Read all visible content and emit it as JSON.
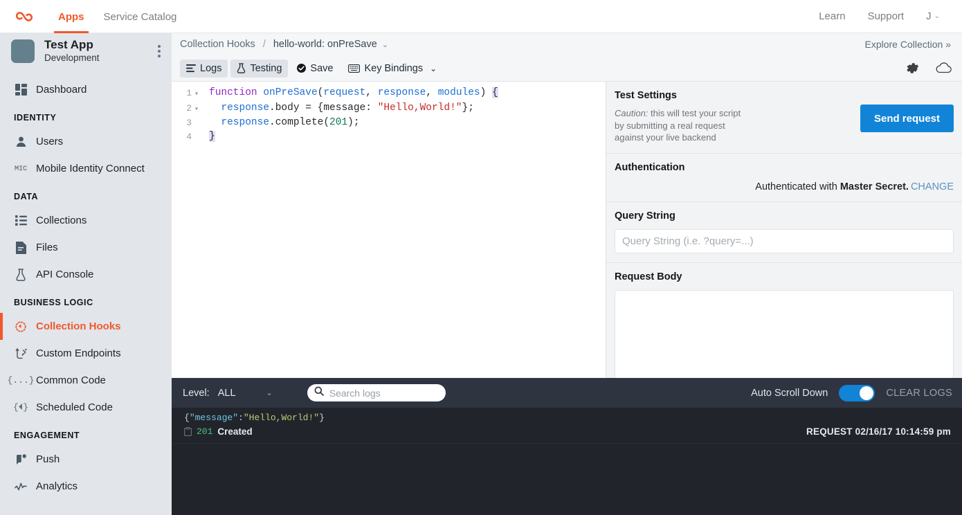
{
  "topbar": {
    "logo_icon": "kinvey-infinity-logo",
    "nav": [
      {
        "label": "Apps",
        "active": true
      },
      {
        "label": "Service Catalog",
        "active": false
      }
    ],
    "right": [
      {
        "label": "Learn"
      },
      {
        "label": "Support"
      },
      {
        "label": "J",
        "caret": "⌄"
      }
    ]
  },
  "sidebar": {
    "app_title": "Test App",
    "app_environment": "Development",
    "items": [
      {
        "label": "Dashboard",
        "icon": "dashboard-icon",
        "type": "item",
        "active": false
      },
      {
        "label": "IDENTITY",
        "type": "section"
      },
      {
        "label": "Users",
        "icon": "user-icon",
        "type": "item",
        "active": false
      },
      {
        "label": "Mobile Identity Connect",
        "icon": "mic-icon",
        "type": "item",
        "active": false
      },
      {
        "label": "DATA",
        "type": "section"
      },
      {
        "label": "Collections",
        "icon": "collections-list-icon",
        "type": "item",
        "active": false
      },
      {
        "label": "Files",
        "icon": "file-icon",
        "type": "item",
        "active": false
      },
      {
        "label": "API Console",
        "icon": "flask-icon",
        "type": "item",
        "active": false
      },
      {
        "label": "BUSINESS LOGIC",
        "type": "section"
      },
      {
        "label": "Collection Hooks",
        "icon": "hook-dotted-circle-icon",
        "type": "item",
        "active": true
      },
      {
        "label": "Custom Endpoints",
        "icon": "endpoints-icon",
        "type": "item",
        "active": false
      },
      {
        "label": "Common Code",
        "icon": "braces-dots-icon",
        "type": "item",
        "active": false
      },
      {
        "label": "Scheduled Code",
        "icon": "braces-clock-icon",
        "type": "item",
        "active": false
      },
      {
        "label": "ENGAGEMENT",
        "type": "section"
      },
      {
        "label": "Push",
        "icon": "push-icon",
        "type": "item",
        "active": false
      },
      {
        "label": "Analytics",
        "icon": "analytics-icon",
        "type": "item",
        "active": false
      }
    ]
  },
  "breadcrumb": {
    "root": "Collection Hooks",
    "separator": "/",
    "current": "hello-world: onPreSave",
    "caret": "⌄",
    "explore": "Explore Collection »"
  },
  "toolbar": {
    "logs_label": "Logs",
    "testing_label": "Testing",
    "save_label": "Save",
    "key_bindings_label": "Key Bindings",
    "key_bindings_caret": "⌄",
    "settings_icon": "gear-icon",
    "cloud_icon": "cloud-icon"
  },
  "editor": {
    "lines": [
      {
        "num": "1",
        "fold": "▾"
      },
      {
        "num": "2",
        "fold": "▾"
      },
      {
        "num": "3",
        "fold": ""
      },
      {
        "num": "4",
        "fold": ""
      }
    ],
    "code_line_1": "function onPreSave(request, response, modules) {",
    "code_line_2": "  response.body = {message: \"Hello,World!\"};",
    "code_line_3": "  response.complete(201);",
    "code_line_4": "}",
    "tokens": {
      "kw_function": "function",
      "fn_name": "onPreSave",
      "p_request": "request",
      "p_response": "response",
      "p_modules": "modules",
      "str_hello": "\"Hello,World!\"",
      "num_201": "201"
    }
  },
  "test_panel": {
    "settings_heading": "Test Settings",
    "caution_label": "Caution:",
    "caution_text": " this will test your script by submitting a real request against your live backend",
    "send_button": "Send request",
    "auth_heading": "Authentication",
    "auth_prefix": "Authenticated with ",
    "auth_mode": "Master Secret.",
    "auth_change": "CHANGE",
    "query_heading": "Query String",
    "query_placeholder": "Query String (i.e. ?query=...)",
    "query_value": "",
    "body_heading": "Request Body",
    "body_value": ""
  },
  "logs": {
    "level_label": "Level:",
    "level_value": "ALL",
    "level_caret": "⌄",
    "search_placeholder": "Search logs",
    "search_value": "",
    "search_icon": "search-icon",
    "auto_scroll_label": "Auto Scroll Down",
    "auto_scroll_on": true,
    "clear_logs_label": "CLEAR LOGS",
    "entries": [
      {
        "json_open": "{",
        "json_key": "\"message\"",
        "json_colon": ":",
        "json_value": "\"Hello,World!\"",
        "json_close": "}",
        "status_code": "201",
        "status_text": "Created",
        "timestamp": "REQUEST 02/16/17 10:14:59 pm",
        "copy_icon": "clipboard-icon"
      }
    ]
  },
  "colors": {
    "accent_orange": "#f1582c",
    "primary_blue": "#1284d8",
    "sidebar_bg": "#e2e5ea",
    "logs_header_bg": "#2e3440",
    "logs_body_bg": "#21252b",
    "status_green": "#4fc07a"
  }
}
